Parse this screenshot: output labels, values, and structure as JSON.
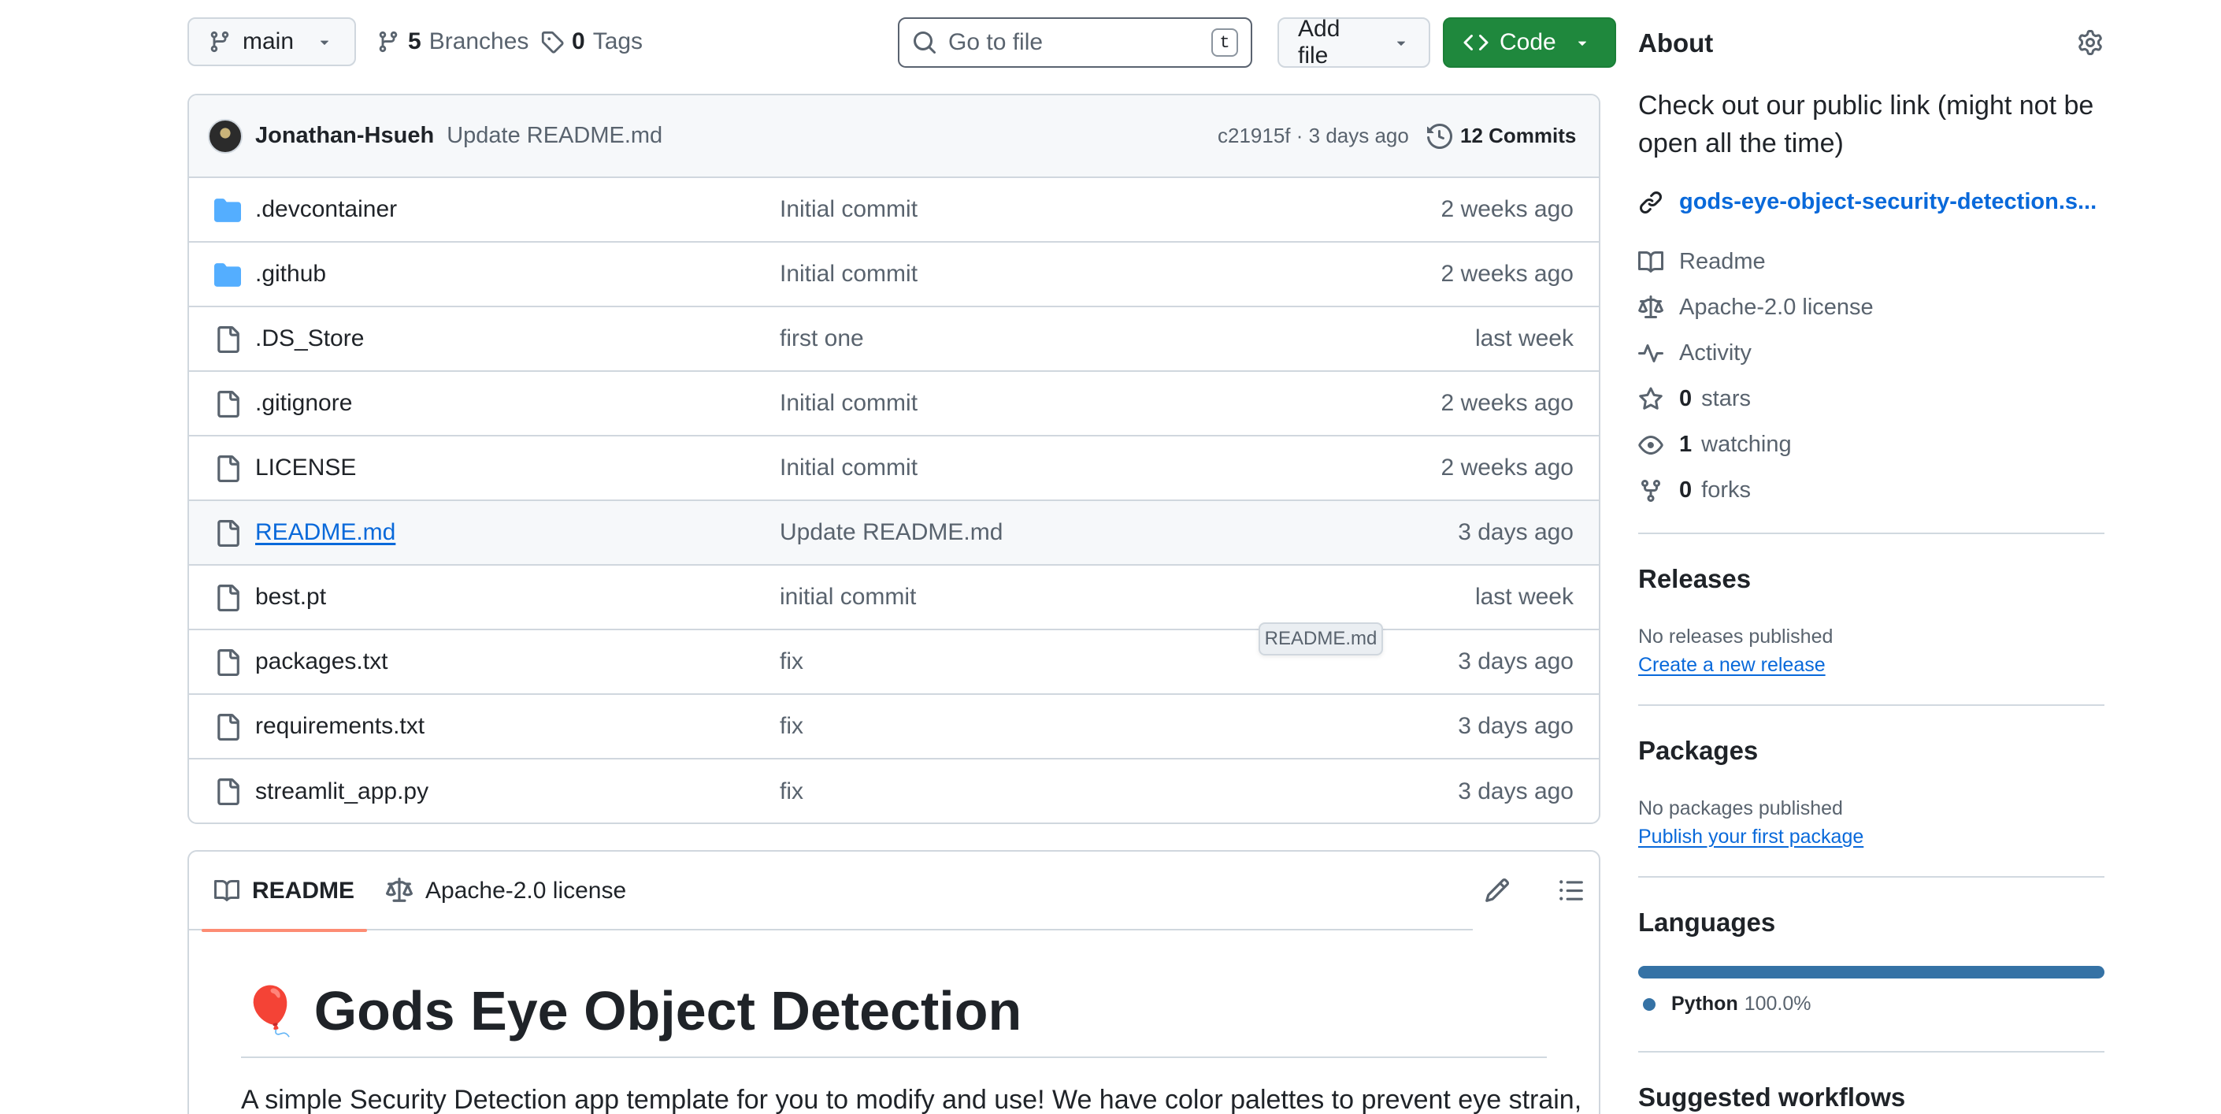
{
  "toolbar": {
    "branch": "main",
    "branches_count": "5",
    "branches_label": "Branches",
    "tags_count": "0",
    "tags_label": "Tags",
    "search_placeholder": "Go to file",
    "search_shortcut": "t",
    "add_file_label": "Add file",
    "code_label": "Code"
  },
  "commit": {
    "author": "Jonathan-Hsueh",
    "message": "Update README.md",
    "hash_time": "c21915f · 3 days ago",
    "commits_label": "12 Commits"
  },
  "files": [
    {
      "name": ".devcontainer",
      "type": "folder",
      "message": "Initial commit",
      "date": "2 weeks ago"
    },
    {
      "name": ".github",
      "type": "folder",
      "message": "Initial commit",
      "date": "2 weeks ago"
    },
    {
      "name": ".DS_Store",
      "type": "file",
      "message": "first one",
      "date": "last week"
    },
    {
      "name": ".gitignore",
      "type": "file",
      "message": "Initial commit",
      "date": "2 weeks ago"
    },
    {
      "name": "LICENSE",
      "type": "file",
      "message": "Initial commit",
      "date": "2 weeks ago"
    },
    {
      "name": "README.md",
      "type": "file",
      "message": "Update README.md",
      "date": "3 days ago"
    },
    {
      "name": "best.pt",
      "type": "file",
      "message": "initial commit",
      "date": "last week"
    },
    {
      "name": "packages.txt",
      "type": "file",
      "message": "fix",
      "date": "3 days ago"
    },
    {
      "name": "requirements.txt",
      "type": "file",
      "message": "fix",
      "date": "3 days ago"
    },
    {
      "name": "streamlit_app.py",
      "type": "file",
      "message": "fix",
      "date": "3 days ago"
    }
  ],
  "tooltip": "README.md",
  "readme": {
    "tab_readme": "README",
    "tab_license": "Apache-2.0 license",
    "title_emoji": "🎈",
    "title": "Gods Eye Object Detection",
    "intro": "A simple Security Detection app template for you to modify and use! We have color palettes to prevent eye strain,"
  },
  "about": {
    "heading": "About",
    "description": "Check out our public link (might not be open all the time)",
    "website": "gods-eye-object-security-detection.s...",
    "readme": "Readme",
    "license": "Apache-2.0 license",
    "activity": "Activity",
    "stars_count": "0",
    "stars_label": "stars",
    "watching_count": "1",
    "watching_label": "watching",
    "forks_count": "0",
    "forks_label": "forks"
  },
  "releases": {
    "heading": "Releases",
    "status": "No releases published",
    "link": "Create a new release"
  },
  "packages": {
    "heading": "Packages",
    "status": "No packages published",
    "link": "Publish your first package"
  },
  "languages": {
    "heading": "Languages",
    "items": [
      {
        "name": "Python",
        "percent": "100.0%",
        "fraction": 1.0,
        "color": "#3572A5"
      }
    ]
  },
  "suggested": {
    "heading": "Suggested workflows"
  }
}
